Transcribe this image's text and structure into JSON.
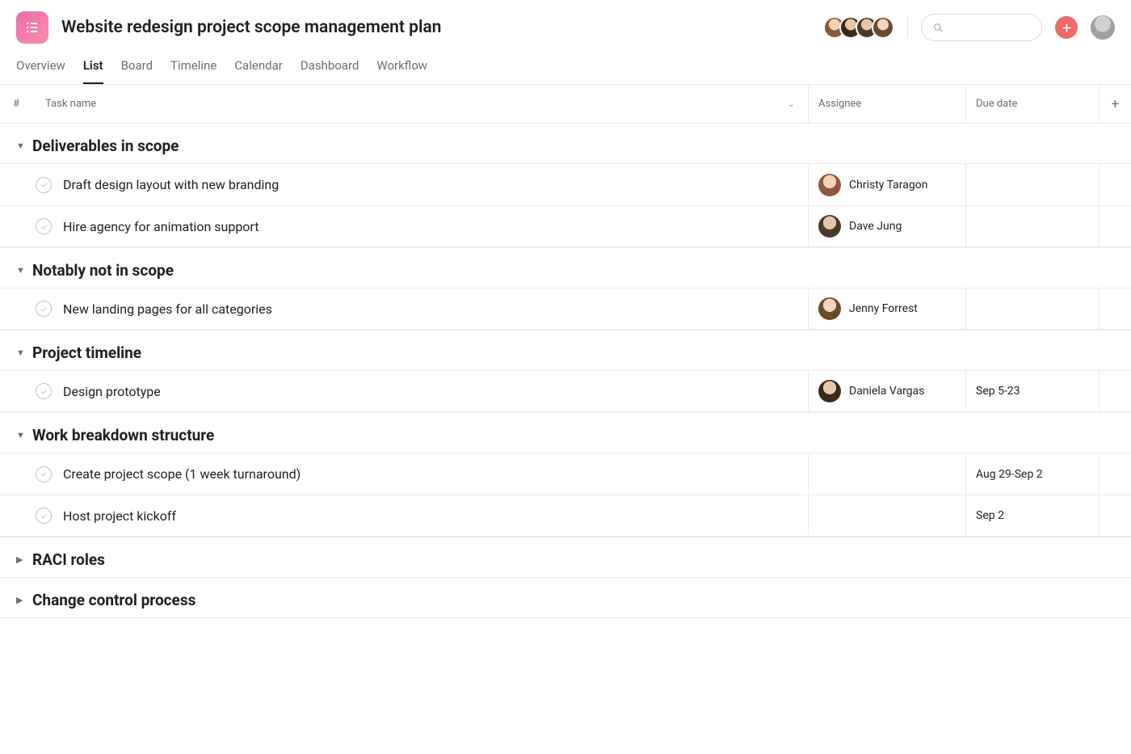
{
  "project": {
    "title": "Website redesign project scope management plan"
  },
  "tabs": [
    {
      "label": "Overview",
      "active": false
    },
    {
      "label": "List",
      "active": true
    },
    {
      "label": "Board",
      "active": false
    },
    {
      "label": "Timeline",
      "active": false
    },
    {
      "label": "Calendar",
      "active": false
    },
    {
      "label": "Dashboard",
      "active": false
    },
    {
      "label": "Workflow",
      "active": false
    }
  ],
  "columns": {
    "num": "#",
    "task": "Task name",
    "assignee": "Assignee",
    "due": "Due date"
  },
  "sections": [
    {
      "title": "Deliverables in scope",
      "expanded": true,
      "tasks": [
        {
          "name": "Draft design layout with new branding",
          "assignee": "Christy Taragon",
          "due": ""
        },
        {
          "name": "Hire agency for animation support",
          "assignee": "Dave Jung",
          "due": ""
        }
      ]
    },
    {
      "title": "Notably not in scope",
      "expanded": true,
      "tasks": [
        {
          "name": "New landing pages for all categories",
          "assignee": "Jenny Forrest",
          "due": ""
        }
      ]
    },
    {
      "title": "Project timeline",
      "expanded": true,
      "tasks": [
        {
          "name": "Design prototype",
          "assignee": "Daniela Vargas",
          "due": "Sep 5-23"
        }
      ]
    },
    {
      "title": "Work breakdown structure",
      "expanded": true,
      "tasks": [
        {
          "name": "Create project scope (1 week turnaround)",
          "assignee": "",
          "due": "Aug 29-Sep 2"
        },
        {
          "name": "Host project kickoff",
          "assignee": "",
          "due": "Sep 2"
        }
      ]
    },
    {
      "title": "RACI roles",
      "expanded": false,
      "tasks": []
    },
    {
      "title": "Change control process",
      "expanded": false,
      "tasks": []
    }
  ]
}
